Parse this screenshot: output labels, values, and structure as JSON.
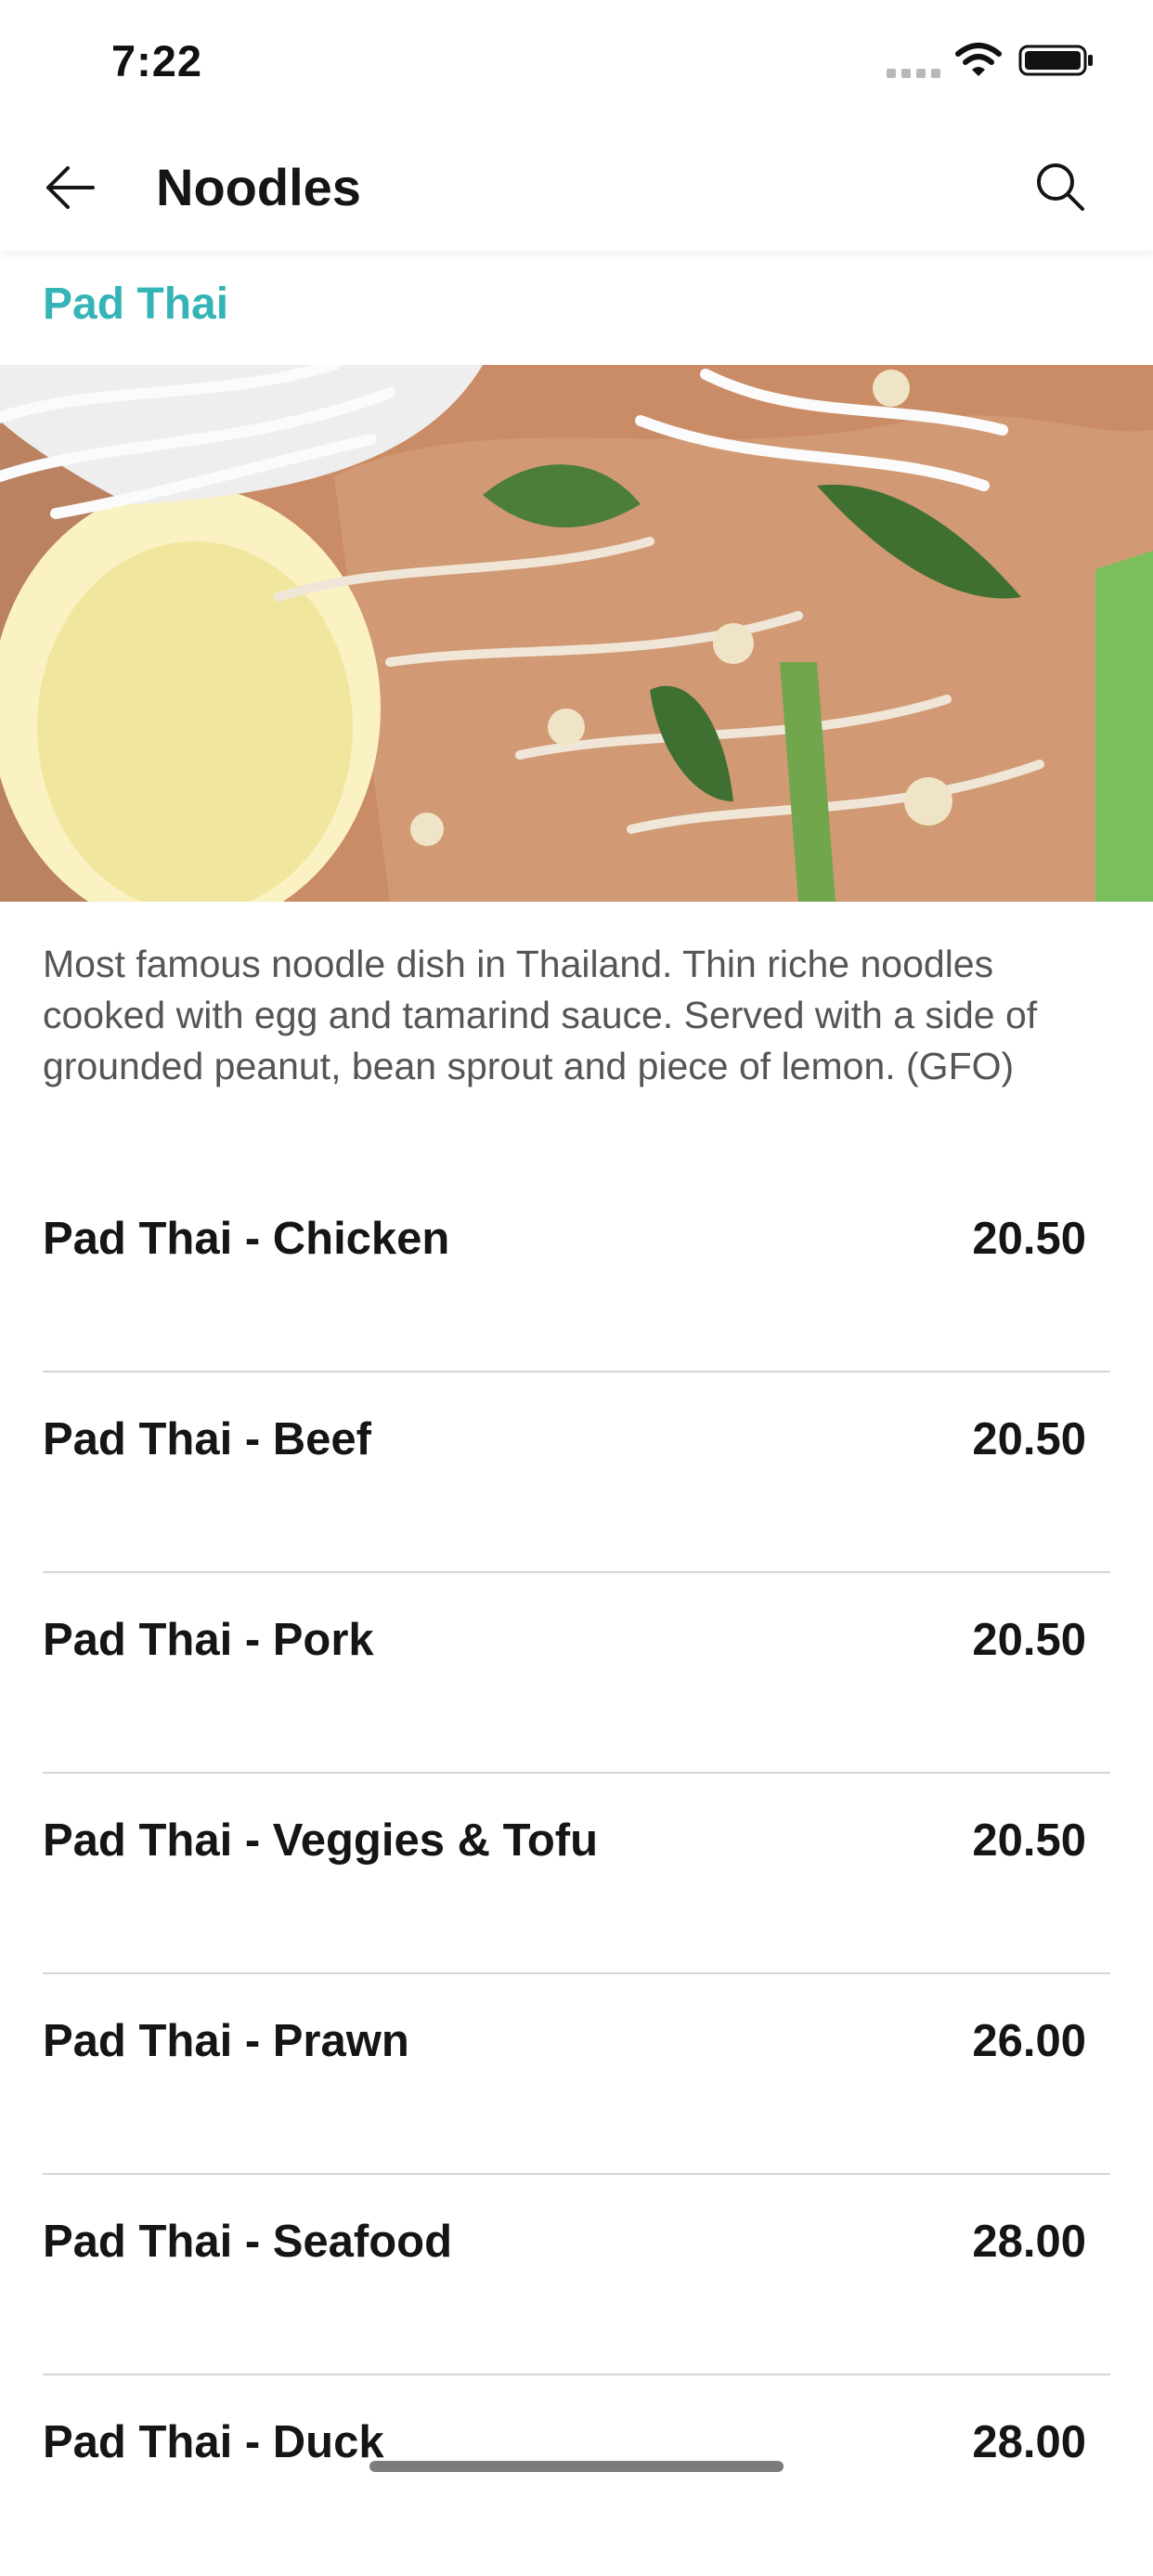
{
  "status_bar": {
    "time": "7:22"
  },
  "header": {
    "title": "Noodles"
  },
  "section": {
    "title": "Pad Thai",
    "description": "Most famous noodle dish in Thailand. Thin riche noodles cooked with egg and tamarind sauce. Served with a side of grounded peanut, bean sprout and piece of lemon. (GFO)"
  },
  "menu": {
    "items": [
      {
        "name": "Pad Thai - Chicken",
        "price": "20.50"
      },
      {
        "name": "Pad Thai - Beef",
        "price": "20.50"
      },
      {
        "name": "Pad Thai - Pork",
        "price": "20.50"
      },
      {
        "name": "Pad Thai - Veggies & Tofu",
        "price": "20.50"
      },
      {
        "name": "Pad Thai - Prawn",
        "price": "26.00"
      },
      {
        "name": "Pad Thai - Seafood",
        "price": "28.00"
      },
      {
        "name": "Pad Thai - Duck",
        "price": "28.00"
      }
    ]
  },
  "icons": {
    "back": "arrow-left-icon",
    "search": "search-icon",
    "wifi": "wifi-icon",
    "battery": "battery-icon"
  },
  "colors": {
    "accent": "#35b4b6",
    "text": "#151515",
    "description": "#555555",
    "divider": "#d5d5d5"
  }
}
